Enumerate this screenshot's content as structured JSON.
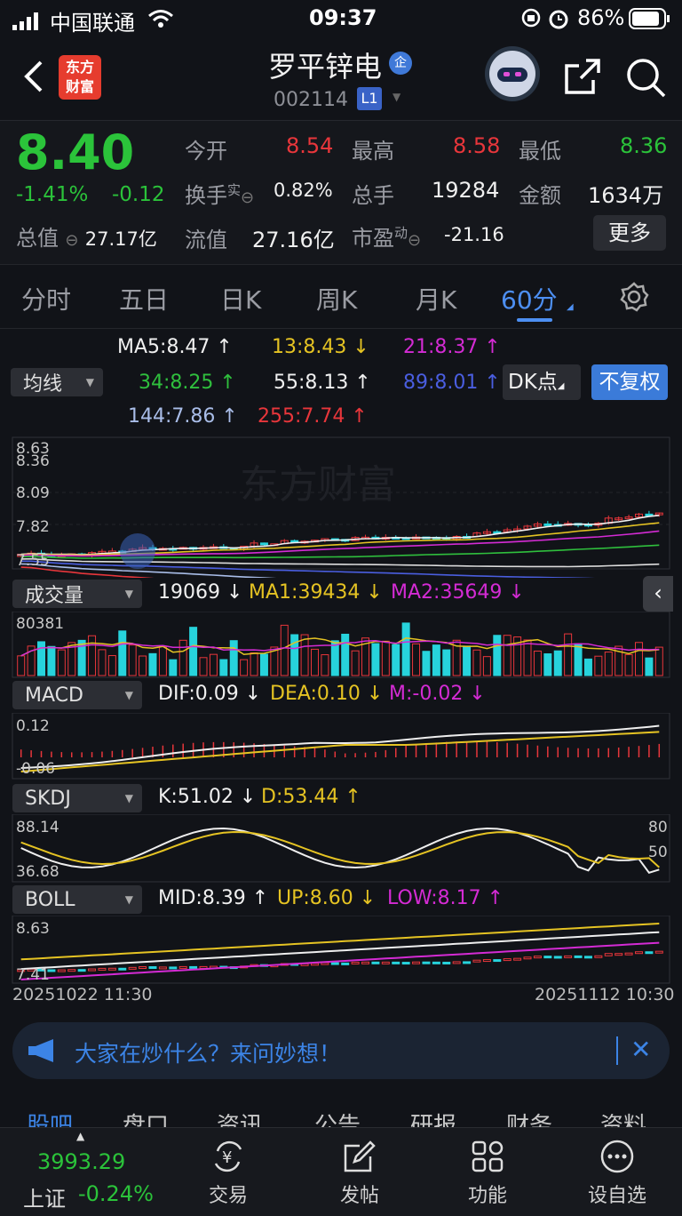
{
  "status_bar": {
    "carrier": "中国联通",
    "time": "09:37",
    "battery": "86%"
  },
  "header": {
    "back_icon": "chevron-left-icon",
    "logo_text_1": "东方",
    "logo_text_2": "财富",
    "stock_name": "罗平锌电",
    "stock_badge": "企",
    "stock_code": "002114",
    "level_badge": "L1",
    "share_icon": "share-icon",
    "search_icon": "search-icon"
  },
  "quote": {
    "price": "8.40",
    "change_pct": "-1.41%",
    "change": "-0.12",
    "open_label": "今开",
    "open": "8.54",
    "high_label": "最高",
    "high": "8.58",
    "low_label": "最低",
    "low": "8.36",
    "turnover_label": "换手",
    "turnover_sup": "实",
    "turnover": "0.82%",
    "volume_label": "总手",
    "volume": "19284",
    "amount_label": "金额",
    "amount": "1634万",
    "mktcap_label": "总值",
    "mktcap": "27.17亿",
    "float_label": "流值",
    "float": "27.16亿",
    "pe_label": "市盈",
    "pe_sup": "动",
    "pe": "-21.16",
    "more_label": "更多"
  },
  "tabs": [
    "分时",
    "五日",
    "日K",
    "周K",
    "月K",
    "60分"
  ],
  "active_tab": "60分",
  "ma": {
    "selector": "均线",
    "ma5": "MA5:8.47",
    "ma13": "13:8.43",
    "ma21": "21:8.37",
    "ma34": "34:8.25",
    "ma55": "55:8.13",
    "ma89": "89:8.01",
    "ma144": "144:7.86",
    "ma255": "255:7.74",
    "dk_button": "DK点",
    "adjust_button": "不复权"
  },
  "main_chart": {
    "y_labels": [
      "8.63",
      "8.36",
      "8.09",
      "7.82",
      "7.55"
    ],
    "watermark": "东方财富"
  },
  "volume_panel": {
    "selector": "成交量",
    "vol": "19069",
    "ma1": "MA1:39434",
    "ma2": "MA2:35649",
    "y_label": "80381"
  },
  "macd_panel": {
    "selector": "MACD",
    "dif": "DIF:0.09",
    "dea": "DEA:0.10",
    "m": "M:-0.02",
    "y_top": "0.12",
    "y_bottom": "-0.06"
  },
  "skdj_panel": {
    "selector": "SKDJ",
    "k": "K:51.02",
    "d": "D:53.44",
    "y_top": "88.14",
    "y_bottom": "36.68",
    "r80": "80",
    "r50": "50"
  },
  "boll_panel": {
    "selector": "BOLL",
    "mid": "MID:8.39",
    "up": "UP:8.60",
    "low": "LOW:8.17",
    "y_top": "8.63",
    "y_bottom": "7.41"
  },
  "time_axis": {
    "start": "20251022 11:30",
    "end": "20251112 10:30"
  },
  "banner": {
    "text": "大家在炒什么？来问妙想！"
  },
  "sub_tabs": [
    "股吧",
    "盘口",
    "资讯",
    "公告",
    "研报",
    "财务",
    "资料"
  ],
  "bottom": {
    "index_value": "3993.29",
    "index_name": "上证",
    "index_change": "-0.24%",
    "trade": "交易",
    "post": "发帖",
    "func": "功能",
    "watch": "设自选"
  }
}
